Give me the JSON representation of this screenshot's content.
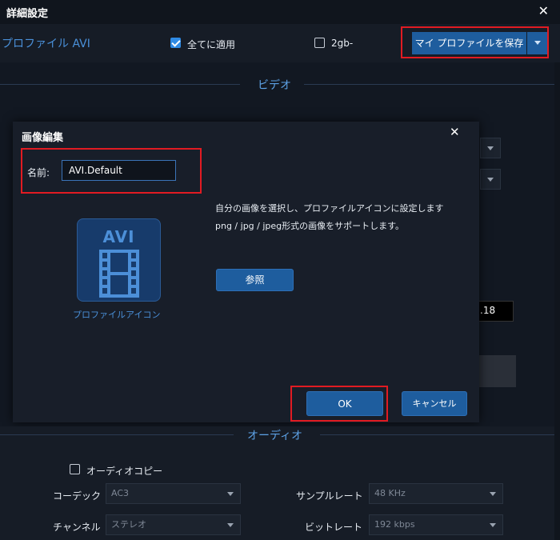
{
  "window": {
    "title": "詳細設定"
  },
  "header": {
    "profile_label": "プロファイル AVI",
    "apply_all_label": "全てに適用",
    "apply_all_checked": true,
    "option2_label": "2gb-",
    "option2_checked": false,
    "save_profile_label": "マイ プロファイルを保存"
  },
  "sections": {
    "video": "ビデオ",
    "audio": "オーディオ"
  },
  "background": {
    "partial_value": ".18"
  },
  "dialog": {
    "title": "画像編集",
    "name_label": "名前:",
    "name_value": "AVI.Default",
    "icon_text": "AVI",
    "icon_caption": "プロファイルアイコン",
    "description_line1": "自分の画像を選択し、プロファイルアイコンに設定します",
    "description_line2": "png / jpg / jpeg形式の画像をサポートします。",
    "browse_label": "参照",
    "ok_label": "OK",
    "cancel_label": "キャンセル"
  },
  "audio": {
    "audio_copy_label": "オーディオコピー",
    "audio_copy_checked": false,
    "codec_label": "コーデック",
    "codec_value": "AC3",
    "samplerate_label": "サンプルレート",
    "samplerate_value": "48 KHz",
    "channel_label": "チャンネル",
    "channel_value": "ステレオ",
    "bitrate_label": "ビットレート",
    "bitrate_value": "192 kbps"
  },
  "colors": {
    "accent": "#1e5d9e",
    "highlight": "#e11b22",
    "link": "#4a90d9"
  }
}
